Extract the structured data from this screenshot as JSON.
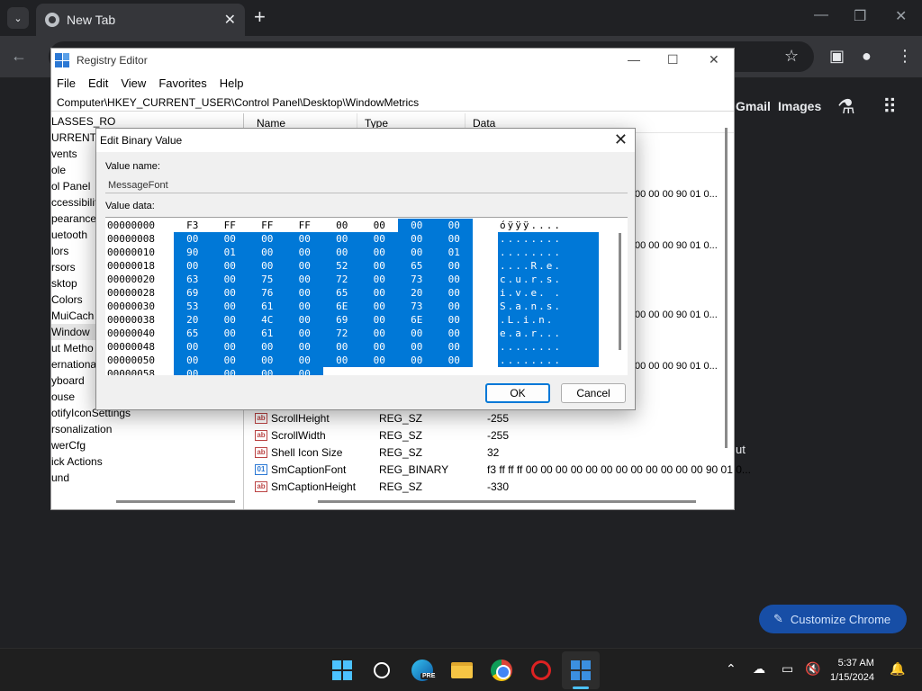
{
  "chrome": {
    "tab_title": "New Tab",
    "new_tab_symbol": "+",
    "links": [
      "Gmail",
      "Images"
    ],
    "shortcut_fragment": "ut",
    "customize_label": "Customize Chrome"
  },
  "regedit": {
    "title": "Registry Editor",
    "menu": [
      "File",
      "Edit",
      "View",
      "Favorites",
      "Help"
    ],
    "address": "Computer\\HKEY_CURRENT_USER\\Control Panel\\Desktop\\WindowMetrics",
    "tree": [
      "LASSES_RO",
      "URRENT_U",
      "vents",
      "ole",
      "ol Panel",
      "ccessibility",
      "pearance",
      "uetooth",
      "lors",
      "rsors",
      "sktop",
      "Colors",
      "MuiCach",
      "Window",
      "ut Metho",
      "ernationa",
      "yboard",
      "ouse",
      "otifyIconSettings",
      "rsonalization",
      "werCfg",
      "ick Actions",
      "und"
    ],
    "columns": [
      "Name",
      "Type",
      "Data"
    ],
    "data_fragments": [
      "00 00 00 90 01 0...",
      "00 00 00 90 01 0...",
      "00 00 00 90 01 0...",
      "00 00 00 90 01 0..."
    ],
    "rows": [
      {
        "name": "ScrollHeight",
        "type": "REG_SZ",
        "data": "-255"
      },
      {
        "name": "ScrollWidth",
        "type": "REG_SZ",
        "data": "-255"
      },
      {
        "name": "Shell Icon Size",
        "type": "REG_SZ",
        "data": "32"
      },
      {
        "name": "SmCaptionFont",
        "type": "REG_BINARY",
        "data": "f3 ff ff ff 00 00 00 00 00 00 00 00 00 00 00 00 90 01 0..."
      },
      {
        "name": "SmCaptionHeight",
        "type": "REG_SZ",
        "data": "-330"
      }
    ]
  },
  "dialog": {
    "title": "Edit Binary Value",
    "value_name_label": "Value name:",
    "value_name": "MessageFont",
    "value_data_label": "Value data:",
    "ok": "OK",
    "cancel": "Cancel",
    "hex_rows": [
      {
        "addr": "00000000",
        "bytes": [
          "F3",
          "FF",
          "FF",
          "FF",
          "00",
          "00",
          "00",
          "00"
        ],
        "ascii": "óÿÿÿ...."
      },
      {
        "addr": "00000008",
        "bytes": [
          "00",
          "00",
          "00",
          "00",
          "00",
          "00",
          "00",
          "00"
        ],
        "ascii": "........"
      },
      {
        "addr": "00000010",
        "bytes": [
          "90",
          "01",
          "00",
          "00",
          "00",
          "00",
          "00",
          "01"
        ],
        "ascii": "........"
      },
      {
        "addr": "00000018",
        "bytes": [
          "00",
          "00",
          "00",
          "00",
          "52",
          "00",
          "65",
          "00"
        ],
        "ascii": "....R.e."
      },
      {
        "addr": "00000020",
        "bytes": [
          "63",
          "00",
          "75",
          "00",
          "72",
          "00",
          "73",
          "00"
        ],
        "ascii": "c.u.r.s."
      },
      {
        "addr": "00000028",
        "bytes": [
          "69",
          "00",
          "76",
          "00",
          "65",
          "00",
          "20",
          "00"
        ],
        "ascii": "i.v.e. ."
      },
      {
        "addr": "00000030",
        "bytes": [
          "53",
          "00",
          "61",
          "00",
          "6E",
          "00",
          "73",
          "00"
        ],
        "ascii": "S.a.n.s."
      },
      {
        "addr": "00000038",
        "bytes": [
          "20",
          "00",
          "4C",
          "00",
          "69",
          "00",
          "6E",
          "00"
        ],
        "ascii": " .L.i.n."
      },
      {
        "addr": "00000040",
        "bytes": [
          "65",
          "00",
          "61",
          "00",
          "72",
          "00",
          "00",
          "00"
        ],
        "ascii": "e.a.r..."
      },
      {
        "addr": "00000048",
        "bytes": [
          "00",
          "00",
          "00",
          "00",
          "00",
          "00",
          "00",
          "00"
        ],
        "ascii": "........"
      },
      {
        "addr": "00000050",
        "bytes": [
          "00",
          "00",
          "00",
          "00",
          "00",
          "00",
          "00",
          "00"
        ],
        "ascii": "........"
      },
      {
        "addr": "00000058",
        "bytes": [
          "00",
          "00",
          "00",
          "00"
        ],
        "ascii": ""
      }
    ]
  },
  "taskbar": {
    "time": "5:37 AM",
    "date": "1/15/2024",
    "edge_badge": "PRE"
  },
  "colors": {
    "chrome_bg": "#202124",
    "selection": "#0078d7",
    "customize_bg": "#174ea6"
  }
}
